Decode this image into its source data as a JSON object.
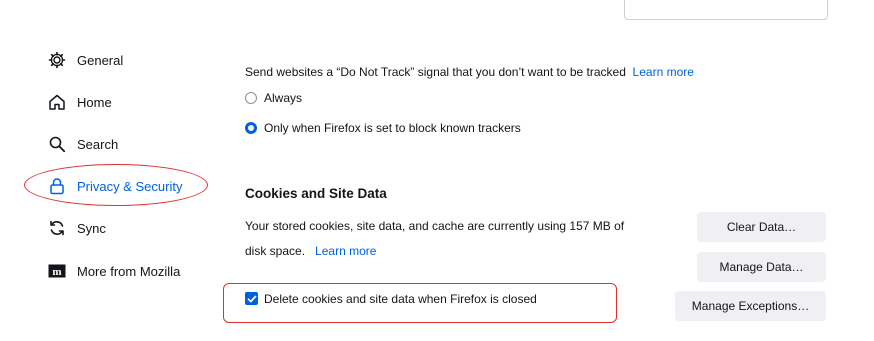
{
  "sidebar": {
    "items": [
      {
        "label": "General",
        "icon": "gear-icon"
      },
      {
        "label": "Home",
        "icon": "home-icon"
      },
      {
        "label": "Search",
        "icon": "search-icon"
      },
      {
        "label": "Privacy & Security",
        "icon": "lock-icon",
        "selected": true
      },
      {
        "label": "Sync",
        "icon": "sync-icon"
      },
      {
        "label": "More from Mozilla",
        "icon": "mozilla-icon"
      }
    ]
  },
  "dnt": {
    "text": "Send websites a “Do Not Track” signal that you don’t want to be tracked",
    "learn_more": "Learn more",
    "options": [
      {
        "label": "Always",
        "checked": false
      },
      {
        "label": "Only when Firefox is set to block known trackers",
        "checked": true
      }
    ]
  },
  "cookies": {
    "heading": "Cookies and Site Data",
    "desc_line1": "Your stored cookies, site data, and cache are currently using 157 MB of",
    "desc_line2": "disk space.",
    "learn_more": "Learn more",
    "clear_button": "Clear Data…",
    "manage_button": "Manage Data…",
    "exceptions_button": "Manage Exceptions…",
    "delete_on_close_label": "Delete cookies and site data when Firefox is closed",
    "delete_on_close_checked": true
  },
  "colors": {
    "accent": "#0061e0",
    "annotation": "#e0302b"
  }
}
